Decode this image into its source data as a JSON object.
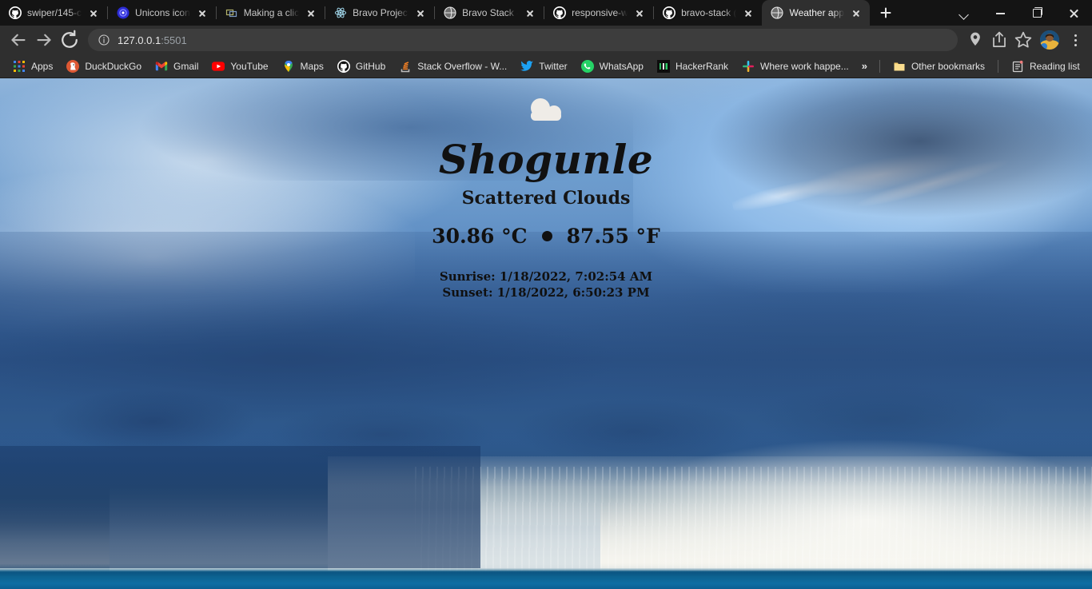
{
  "browser": {
    "tabs": [
      {
        "title": "swiper/145-c",
        "favicon": "github-icon",
        "active": false
      },
      {
        "title": "Unicons icon",
        "favicon": "unicons-icon",
        "active": false
      },
      {
        "title": "Making a clic",
        "favicon": "codepen-icon",
        "active": false
      },
      {
        "title": "Bravo Project",
        "favicon": "react-icon",
        "active": false
      },
      {
        "title": "Bravo Stack -",
        "favicon": "globe-icon",
        "active": false
      },
      {
        "title": "responsive-w",
        "favicon": "github-icon",
        "active": false
      },
      {
        "title": "bravo-stack (",
        "favicon": "github-icon",
        "active": false
      },
      {
        "title": "Weather app",
        "favicon": "globe-icon",
        "active": true
      }
    ],
    "new_tab_label": "+",
    "window_controls": [
      {
        "name": "chevron-down",
        "label": "v"
      },
      {
        "name": "minimize",
        "label": "-"
      },
      {
        "name": "maximize",
        "label": "[]"
      },
      {
        "name": "close",
        "label": "x"
      }
    ],
    "nav": {
      "back_label": "Back",
      "forward_label": "Forward",
      "reload_label": "Reload"
    },
    "omnibox": {
      "site_info_label": "View site information",
      "url_host": "127.0.0.1",
      "url_port": ":5501"
    },
    "toolbar_icons": [
      {
        "name": "location-pin-icon",
        "label": "Location"
      },
      {
        "name": "share-icon",
        "label": "Share this page"
      },
      {
        "name": "star-icon",
        "label": "Bookmark this tab"
      }
    ],
    "profile_label": "Profile",
    "menu_label": "Customize and control Google Chrome",
    "bookmarks": [
      {
        "label": "Apps",
        "icon": "apps-grid-icon"
      },
      {
        "label": "DuckDuckGo",
        "icon": "duckduckgo-icon"
      },
      {
        "label": "Gmail",
        "icon": "gmail-icon"
      },
      {
        "label": "YouTube",
        "icon": "youtube-icon"
      },
      {
        "label": "Maps",
        "icon": "maps-pin-icon"
      },
      {
        "label": "GitHub",
        "icon": "github-icon"
      },
      {
        "label": "Stack Overflow - W...",
        "icon": "stackoverflow-icon"
      },
      {
        "label": "Twitter",
        "icon": "twitter-icon"
      },
      {
        "label": "WhatsApp",
        "icon": "whatsapp-icon"
      },
      {
        "label": "HackerRank",
        "icon": "hackerrank-icon"
      },
      {
        "label": "Where work happe...",
        "icon": "slack-icon"
      }
    ],
    "overflow_label": "»",
    "other_bookmarks": {
      "label": "Other bookmarks",
      "icon": "folder-icon"
    },
    "reading_list": {
      "label": "Reading list",
      "icon": "reading-list-icon"
    }
  },
  "weather": {
    "icon_name": "cloud-icon",
    "city": "Shogunle",
    "description": "Scattered Clouds",
    "temp_celsius": "30.86 °C",
    "temp_fahrenheit": "87.55 °F",
    "separator": "●",
    "sunrise": "Sunrise: 1/18/2022, 7:02:54 AM",
    "sunset": "Sunset: 1/18/2022, 6:50:23 PM"
  },
  "colors": {
    "chrome_tabstrip": "#141414",
    "chrome_toolbar": "#2f2f2f",
    "active_tab": "#2f2f2f",
    "url_text": "#e8e8e8",
    "url_port": "#9aa0a6",
    "weather_text": "#111111",
    "cloud_icon": "#eeece8",
    "sky_blue": "#7ba6d4",
    "ocean_blue": "#0d5a86"
  }
}
